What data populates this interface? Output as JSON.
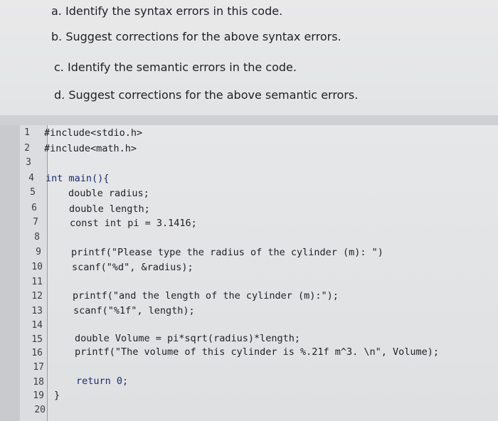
{
  "questions": [
    {
      "text": "a. Identify the syntax errors in this code."
    },
    {
      "text": "b. Suggest corrections for the above syntax errors."
    },
    {
      "text": "c. Identify the semantic errors in the code."
    },
    {
      "text": "d. Suggest corrections for the above semantic errors."
    }
  ],
  "code_lines": [
    {
      "n": "1",
      "text": "#include<stdio.h>"
    },
    {
      "n": "2",
      "text": "#include<math.h>"
    },
    {
      "n": "3",
      "text": ""
    },
    {
      "n": "4",
      "text": "int main(){"
    },
    {
      "n": "5",
      "text": "double radius;"
    },
    {
      "n": "6",
      "text": "double length;"
    },
    {
      "n": "7",
      "text": "const int pi = 3.1416;"
    },
    {
      "n": "8",
      "text": ""
    },
    {
      "n": "9",
      "text": "printf(\"Please type the radius of the cylinder (m): \")"
    },
    {
      "n": "10",
      "text": "scanf(\"%d\", &radius);"
    },
    {
      "n": "11",
      "text": ""
    },
    {
      "n": "12",
      "text": "printf(\"and the length of the cylinder (m):\");"
    },
    {
      "n": "13",
      "text": "scanf(\"%1f\", length);"
    },
    {
      "n": "14",
      "text": ""
    },
    {
      "n": "15",
      "text": "double Volume = pi*sqrt(radius)*length;"
    },
    {
      "n": "16",
      "text": "printf(\"The volume of this cylinder is %.21f m^3. \\n\", Volume);"
    },
    {
      "n": "17",
      "text": ""
    },
    {
      "n": "18",
      "text": "return 0;"
    },
    {
      "n": "19",
      "text": "}"
    },
    {
      "n": "20",
      "text": ""
    }
  ]
}
